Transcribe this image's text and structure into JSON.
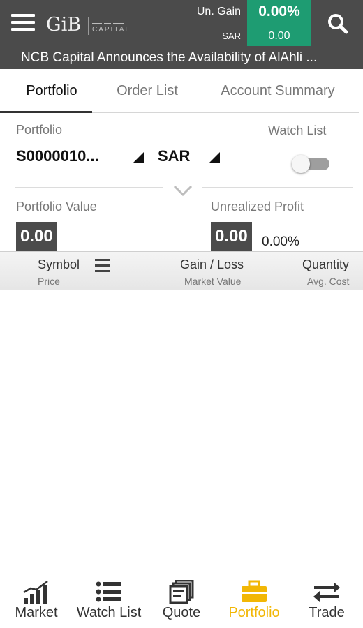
{
  "header": {
    "brand_primary": "GiB",
    "brand_secondary": "CAPITAL",
    "unrealized_gain_label": "Un. Gain",
    "currency_label": "SAR",
    "gain_percent": "0.00%",
    "gain_value": "0.00",
    "gain_color": "#1e9c72",
    "background_color": "#4b4b4b",
    "icons": {
      "menu": "menu-icon",
      "search": "search-icon"
    }
  },
  "ticker": {
    "text": "NCB Capital Announces the Availability of AlAhli ..."
  },
  "tabs": [
    {
      "label": "Portfolio",
      "active": true
    },
    {
      "label": "Order List",
      "active": false
    },
    {
      "label": "Account Summary",
      "active": false
    }
  ],
  "selectors": {
    "portfolio_label": "Portfolio",
    "portfolio_value": "S0000010...",
    "currency_value": "SAR",
    "watchlist_label": "Watch List",
    "watchlist_enabled": false
  },
  "summary": {
    "portfolio_value_label": "Portfolio Value",
    "portfolio_value": "0.00",
    "unrealized_profit_label": "Unrealized Profit",
    "unrealized_profit": "0.00",
    "unrealized_profit_percent": "0.00%"
  },
  "table": {
    "columns": [
      {
        "main": "Symbol",
        "sub": "Price"
      },
      {
        "main": "Gain / Loss",
        "sub": "Market Value"
      },
      {
        "main": "Quantity",
        "sub": "Avg. Cost"
      }
    ],
    "rows": []
  },
  "bottom_nav": {
    "active_color": "#f2b705",
    "items": [
      {
        "label": "Market",
        "icon": "bar-chart-icon",
        "active": false
      },
      {
        "label": "Watch List",
        "icon": "list-icon",
        "active": false
      },
      {
        "label": "Quote",
        "icon": "quote-icon",
        "active": false
      },
      {
        "label": "Portfolio",
        "icon": "briefcase-icon",
        "active": true
      },
      {
        "label": "Trade",
        "icon": "swap-arrows-icon",
        "active": false
      }
    ]
  }
}
